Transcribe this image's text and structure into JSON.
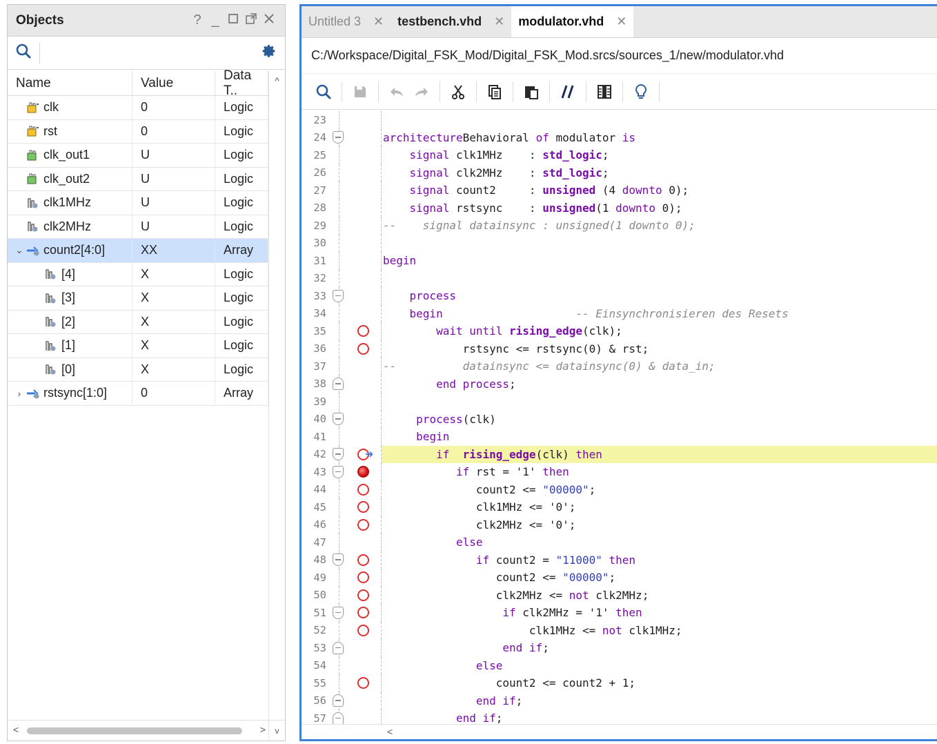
{
  "objects": {
    "title": "Objects",
    "columns": {
      "name": "Name",
      "value": "Value",
      "type": "Data T.."
    },
    "rows": [
      {
        "name": "clk",
        "value": "0",
        "type": "Logic",
        "icon": "input-signal-icon",
        "indent": 0,
        "expander": ""
      },
      {
        "name": "rst",
        "value": "0",
        "type": "Logic",
        "icon": "input-signal-icon",
        "indent": 0,
        "expander": ""
      },
      {
        "name": "clk_out1",
        "value": "U",
        "type": "Logic",
        "icon": "output-signal-icon",
        "indent": 0,
        "expander": ""
      },
      {
        "name": "clk_out2",
        "value": "U",
        "type": "Logic",
        "icon": "output-signal-icon",
        "indent": 0,
        "expander": ""
      },
      {
        "name": "clk1MHz",
        "value": "U",
        "type": "Logic",
        "icon": "internal-signal-icon",
        "indent": 0,
        "expander": ""
      },
      {
        "name": "clk2MHz",
        "value": "U",
        "type": "Logic",
        "icon": "internal-signal-icon",
        "indent": 0,
        "expander": ""
      },
      {
        "name": "count2[4:0]",
        "value": "XX",
        "type": "Array",
        "icon": "array-signal-icon",
        "indent": 0,
        "expander": "⌄",
        "selected": true
      },
      {
        "name": "[4]",
        "value": "X",
        "type": "Logic",
        "icon": "internal-signal-icon",
        "indent": 1,
        "expander": ""
      },
      {
        "name": "[3]",
        "value": "X",
        "type": "Logic",
        "icon": "internal-signal-icon",
        "indent": 1,
        "expander": ""
      },
      {
        "name": "[2]",
        "value": "X",
        "type": "Logic",
        "icon": "internal-signal-icon",
        "indent": 1,
        "expander": ""
      },
      {
        "name": "[1]",
        "value": "X",
        "type": "Logic",
        "icon": "internal-signal-icon",
        "indent": 1,
        "expander": ""
      },
      {
        "name": "[0]",
        "value": "X",
        "type": "Logic",
        "icon": "internal-signal-icon",
        "indent": 1,
        "expander": ""
      },
      {
        "name": "rstsync[1:0]",
        "value": "0",
        "type": "Array",
        "icon": "array-signal-icon",
        "indent": 0,
        "expander": "›"
      }
    ]
  },
  "editor": {
    "tabs": [
      {
        "label": "Untitled 3",
        "state": "inactive"
      },
      {
        "label": "testbench.vhd",
        "state": "bold"
      },
      {
        "label": "modulator.vhd",
        "state": "active"
      }
    ],
    "file_path": "C:/Workspace/Digital_FSK_Mod/Digital_FSK_Mod.srcs/sources_1/new/modulator.vhd",
    "toolbar": [
      "search-icon",
      "save-icon",
      "undo-icon",
      "redo-icon",
      "cut-icon",
      "copy-icon",
      "paste-icon",
      "comment-toggle-icon",
      "column-select-icon",
      "hint-bulb-icon"
    ],
    "lines": [
      {
        "n": "23",
        "fold": "",
        "bp": "",
        "code": []
      },
      {
        "n": "24",
        "fold": "start",
        "bp": "",
        "code": [
          [
            "kw",
            "architecture"
          ],
          [
            "",
            "Behavioral "
          ],
          [
            "kw",
            "of"
          ],
          [
            "",
            " modulator "
          ],
          [
            "kw",
            "is"
          ]
        ]
      },
      {
        "n": "25",
        "fold": "",
        "bp": "",
        "code": [
          [
            "",
            "    "
          ],
          [
            "kw",
            "signal"
          ],
          [
            "",
            " clk1MHz    : "
          ],
          [
            "ty",
            "std_logic"
          ],
          [
            "",
            ";"
          ]
        ]
      },
      {
        "n": "26",
        "fold": "",
        "bp": "",
        "code": [
          [
            "",
            "    "
          ],
          [
            "kw",
            "signal"
          ],
          [
            "",
            " clk2MHz    : "
          ],
          [
            "ty",
            "std_logic"
          ],
          [
            "",
            ";"
          ]
        ]
      },
      {
        "n": "27",
        "fold": "",
        "bp": "",
        "code": [
          [
            "",
            "    "
          ],
          [
            "kw",
            "signal"
          ],
          [
            "",
            " count2     : "
          ],
          [
            "ty",
            "unsigned"
          ],
          [
            "",
            " (4 "
          ],
          [
            "kw",
            "downto"
          ],
          [
            "",
            " 0);"
          ]
        ]
      },
      {
        "n": "28",
        "fold": "",
        "bp": "",
        "code": [
          [
            "",
            "    "
          ],
          [
            "kw",
            "signal"
          ],
          [
            "",
            " rstsync    : "
          ],
          [
            "ty",
            "unsigned"
          ],
          [
            "",
            "(1 "
          ],
          [
            "kw",
            "downto"
          ],
          [
            "",
            " 0);"
          ]
        ]
      },
      {
        "n": "29",
        "fold": "",
        "bp": "",
        "code": [
          [
            "cm",
            "--    signal datainsync : unsigned(1 downto 0);"
          ]
        ]
      },
      {
        "n": "30",
        "fold": "",
        "bp": "",
        "code": []
      },
      {
        "n": "31",
        "fold": "",
        "bp": "",
        "code": [
          [
            "kw",
            "begin"
          ]
        ]
      },
      {
        "n": "32",
        "fold": "",
        "bp": "",
        "code": []
      },
      {
        "n": "33",
        "fold": "start",
        "bp": "",
        "code": [
          [
            "",
            "    "
          ],
          [
            "kw",
            "process"
          ]
        ]
      },
      {
        "n": "34",
        "fold": "",
        "bp": "",
        "code": [
          [
            "",
            "    "
          ],
          [
            "kw",
            "begin"
          ],
          [
            "",
            "                    "
          ],
          [
            "cm",
            "-- Einsynchronisieren des Resets"
          ]
        ]
      },
      {
        "n": "35",
        "fold": "",
        "bp": "open",
        "code": [
          [
            "",
            "        "
          ],
          [
            "kw",
            "wait until"
          ],
          [
            "",
            " "
          ],
          [
            "ty",
            "rising_edge"
          ],
          [
            "",
            "(clk);"
          ]
        ]
      },
      {
        "n": "36",
        "fold": "",
        "bp": "open",
        "code": [
          [
            "",
            "            rstsync <= rstsync(0) & rst;"
          ]
        ]
      },
      {
        "n": "37",
        "fold": "",
        "bp": "",
        "code": [
          [
            "cm",
            "--          datainsync <= datainsync(0) & data_in;"
          ]
        ]
      },
      {
        "n": "38",
        "fold": "end",
        "bp": "",
        "code": [
          [
            "",
            "        "
          ],
          [
            "kw",
            "end process"
          ],
          [
            "",
            ";"
          ]
        ]
      },
      {
        "n": "39",
        "fold": "",
        "bp": "",
        "code": []
      },
      {
        "n": "40",
        "fold": "start",
        "bp": "",
        "code": [
          [
            "",
            "     "
          ],
          [
            "kw",
            "process"
          ],
          [
            "",
            "(clk)"
          ]
        ]
      },
      {
        "n": "41",
        "fold": "",
        "bp": "",
        "code": [
          [
            "",
            "     "
          ],
          [
            "kw",
            "begin"
          ]
        ]
      },
      {
        "n": "42",
        "fold": "start",
        "bp": "current",
        "current": true,
        "code": [
          [
            "",
            "        "
          ],
          [
            "kw",
            "if"
          ],
          [
            "",
            "  "
          ],
          [
            "ty",
            "rising_edge"
          ],
          [
            "",
            "(clk) "
          ],
          [
            "kw",
            "then"
          ]
        ]
      },
      {
        "n": "43",
        "fold": "start",
        "bp": "filled",
        "code": [
          [
            "",
            "           "
          ],
          [
            "kw",
            "if"
          ],
          [
            "",
            " rst = '1' "
          ],
          [
            "kw",
            "then"
          ]
        ]
      },
      {
        "n": "44",
        "fold": "",
        "bp": "open",
        "code": [
          [
            "",
            "              count2 <= "
          ],
          [
            "str",
            "\"00000\""
          ],
          [
            "",
            ";"
          ]
        ]
      },
      {
        "n": "45",
        "fold": "",
        "bp": "open",
        "code": [
          [
            "",
            "              clk1MHz <= '0';"
          ]
        ]
      },
      {
        "n": "46",
        "fold": "",
        "bp": "open",
        "code": [
          [
            "",
            "              clk2MHz <= '0';"
          ]
        ]
      },
      {
        "n": "47",
        "fold": "",
        "bp": "",
        "code": [
          [
            "",
            "           "
          ],
          [
            "kw",
            "else"
          ]
        ]
      },
      {
        "n": "48",
        "fold": "start",
        "bp": "open",
        "code": [
          [
            "",
            "              "
          ],
          [
            "kw",
            "if"
          ],
          [
            "",
            " count2 = "
          ],
          [
            "str",
            "\"11000\""
          ],
          [
            "",
            " "
          ],
          [
            "kw",
            "then"
          ]
        ]
      },
      {
        "n": "49",
        "fold": "",
        "bp": "open",
        "code": [
          [
            "",
            "                 count2 <= "
          ],
          [
            "str",
            "\"00000\""
          ],
          [
            "",
            ";"
          ]
        ]
      },
      {
        "n": "50",
        "fold": "",
        "bp": "open",
        "code": [
          [
            "",
            "                 clk2MHz <= "
          ],
          [
            "kw",
            "not"
          ],
          [
            "",
            " clk2MHz;"
          ]
        ]
      },
      {
        "n": "51",
        "fold": "start",
        "bp": "open",
        "code": [
          [
            "",
            "                  "
          ],
          [
            "kw",
            "if"
          ],
          [
            "",
            " clk2MHz = '1' "
          ],
          [
            "kw",
            "then"
          ]
        ]
      },
      {
        "n": "52",
        "fold": "",
        "bp": "open",
        "code": [
          [
            "",
            "                      clk1MHz <= "
          ],
          [
            "kw",
            "not"
          ],
          [
            "",
            " clk1MHz;"
          ]
        ]
      },
      {
        "n": "53",
        "fold": "end",
        "bp": "",
        "code": [
          [
            "",
            "                  "
          ],
          [
            "kw",
            "end if"
          ],
          [
            "",
            ";"
          ]
        ]
      },
      {
        "n": "54",
        "fold": "",
        "bp": "",
        "code": [
          [
            "",
            "              "
          ],
          [
            "kw",
            "else"
          ]
        ]
      },
      {
        "n": "55",
        "fold": "",
        "bp": "open",
        "code": [
          [
            "",
            "                 count2 <= count2 + 1;"
          ]
        ]
      },
      {
        "n": "56",
        "fold": "end",
        "bp": "",
        "code": [
          [
            "",
            "              "
          ],
          [
            "kw",
            "end if"
          ],
          [
            "",
            ";"
          ]
        ]
      },
      {
        "n": "57",
        "fold": "end",
        "bp": "",
        "code": [
          [
            "",
            "           "
          ],
          [
            "kw",
            "end if"
          ],
          [
            "",
            ";"
          ]
        ]
      }
    ]
  },
  "colors": {
    "accent_border": "#3f7fd8",
    "selection": "#cce0fb",
    "current_line": "#f4f6a6",
    "keyword": "#7a0aaa",
    "breakpoint": "#e03030",
    "exec_arrow": "#2f7fe0"
  }
}
